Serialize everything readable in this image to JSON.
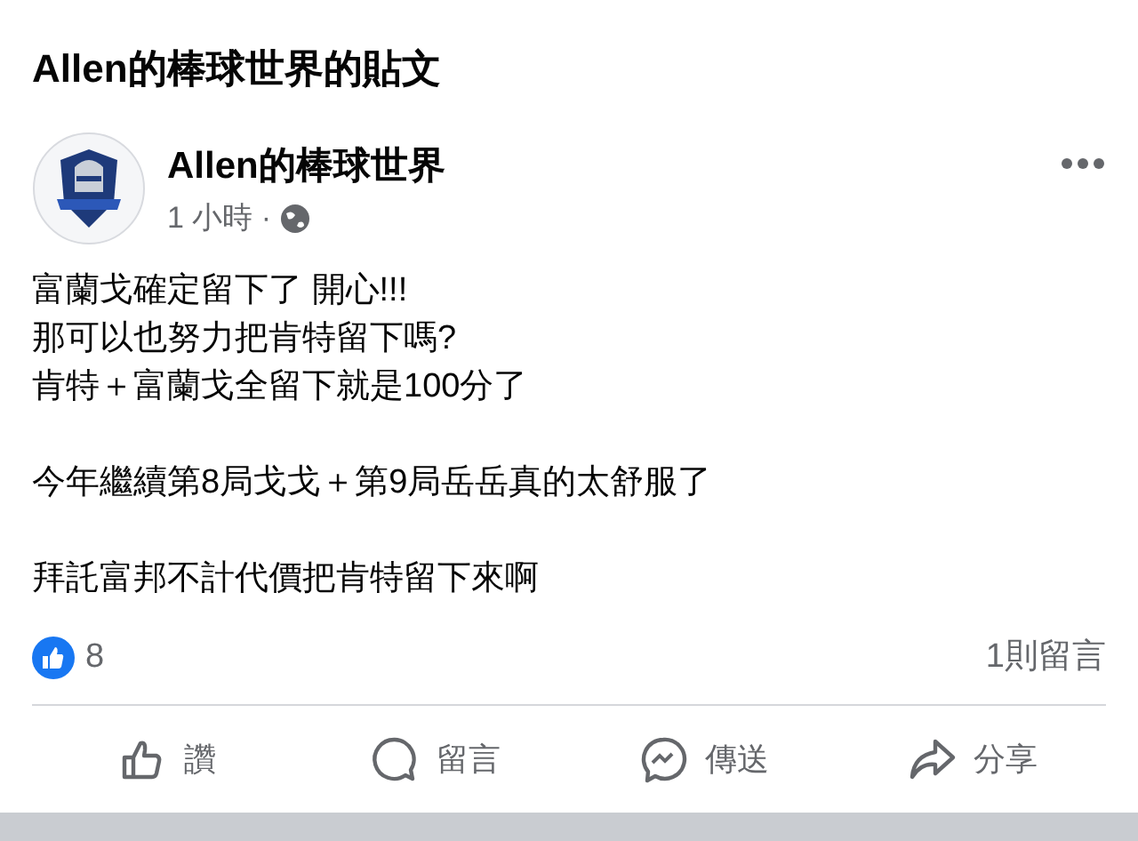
{
  "header": {
    "title": "Allen的棒球世界的貼文"
  },
  "post": {
    "author": "Allen的棒球世界",
    "time": "1 小時 ·",
    "paragraphs": [
      "富蘭戈確定留下了  開心!!!\n那可以也努力把肯特留下嗎?\n肯特＋富蘭戈全留下就是100分了",
      "今年繼續第8局戈戈＋第9局岳岳真的太舒服了",
      "拜託富邦不計代價把肯特留下來啊"
    ],
    "reactions": {
      "count": "8",
      "comments": "1則留言"
    },
    "actions": [
      {
        "kind": "like",
        "label": "讚"
      },
      {
        "kind": "comment",
        "label": "留言"
      },
      {
        "kind": "send",
        "label": "傳送"
      },
      {
        "kind": "share",
        "label": "分享"
      }
    ]
  }
}
